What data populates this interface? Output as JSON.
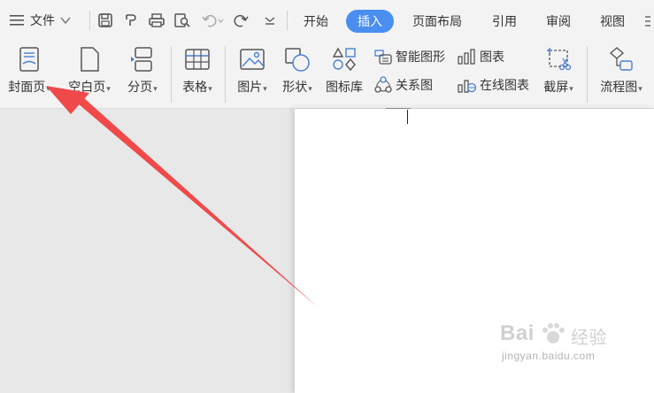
{
  "menu": {
    "file_label": "文件"
  },
  "tabs": [
    {
      "label": "开始"
    },
    {
      "label": "插入"
    },
    {
      "label": "页面布局"
    },
    {
      "label": "引用"
    },
    {
      "label": "审阅"
    },
    {
      "label": "视图"
    }
  ],
  "ribbon": {
    "cover_page": "封面页",
    "blank_page": "空白页",
    "page_break": "分页",
    "table": "表格",
    "picture": "图片",
    "shape": "形状",
    "icon_library": "图标库",
    "smart_art": "智能图形",
    "relation_chart": "关系图",
    "chart": "图表",
    "online_chart": "在线图表",
    "screenshot": "截屏",
    "flowchart": "流程图"
  },
  "watermark": {
    "brand": "Bai",
    "suffix": "经验",
    "url": "jingyan.baidu.com"
  },
  "colors": {
    "accent": "#4a8ef0",
    "arrow": "#f0494a",
    "icon_blue": "#4a7fd4"
  }
}
